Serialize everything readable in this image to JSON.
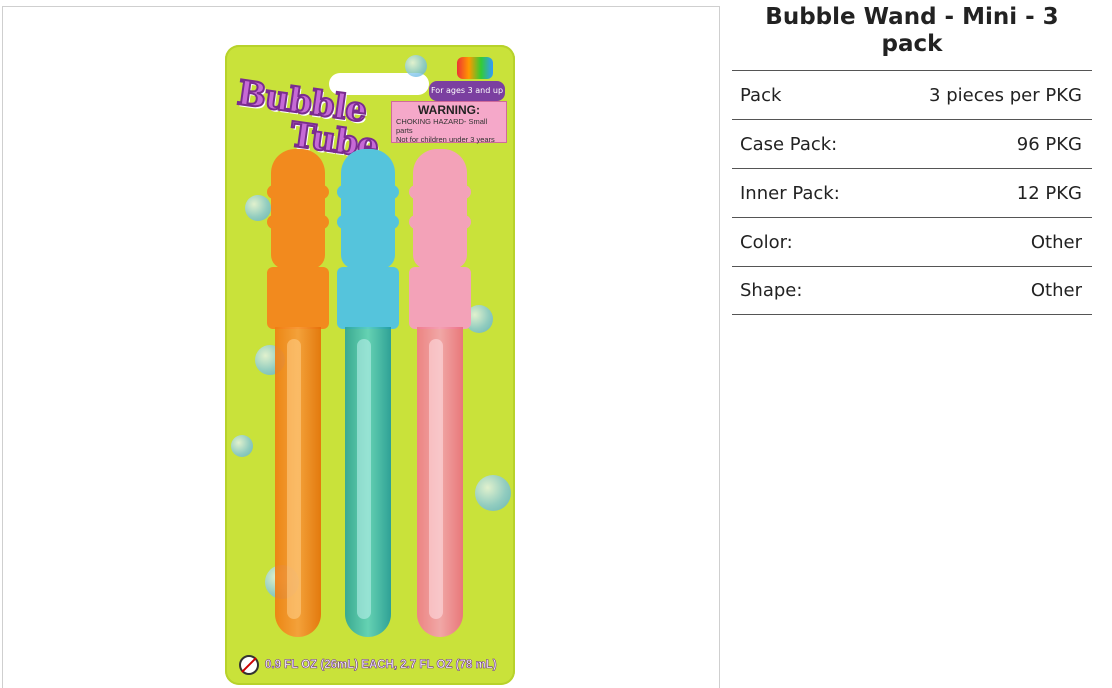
{
  "product": {
    "title": "Bubble Wand - Mini - 3 pack",
    "image": {
      "brand_logo_line1": "Bubble",
      "brand_logo_line2": "Tube",
      "age_badge": "For ages 3 and up",
      "warning_title": "WARNING:",
      "warning_line1": "CHOKING HAZARD- Small parts",
      "warning_line2": "Not for children under 3 years",
      "volume_text": "0.9 FL OZ (26mL) EACH, 2.7 FL OZ (78 mL)",
      "wand_colors": [
        "#f28a1e",
        "#55c4dc",
        "#f3a2b8"
      ],
      "card_color": "#c9e23a"
    }
  },
  "specs": [
    {
      "label": "Pack",
      "value": "3 pieces per PKG"
    },
    {
      "label": "Case Pack:",
      "value": "96 PKG"
    },
    {
      "label": "Inner Pack:",
      "value": "12 PKG"
    },
    {
      "label": "Color:",
      "value": "Other"
    },
    {
      "label": "Shape:",
      "value": "Other"
    }
  ]
}
